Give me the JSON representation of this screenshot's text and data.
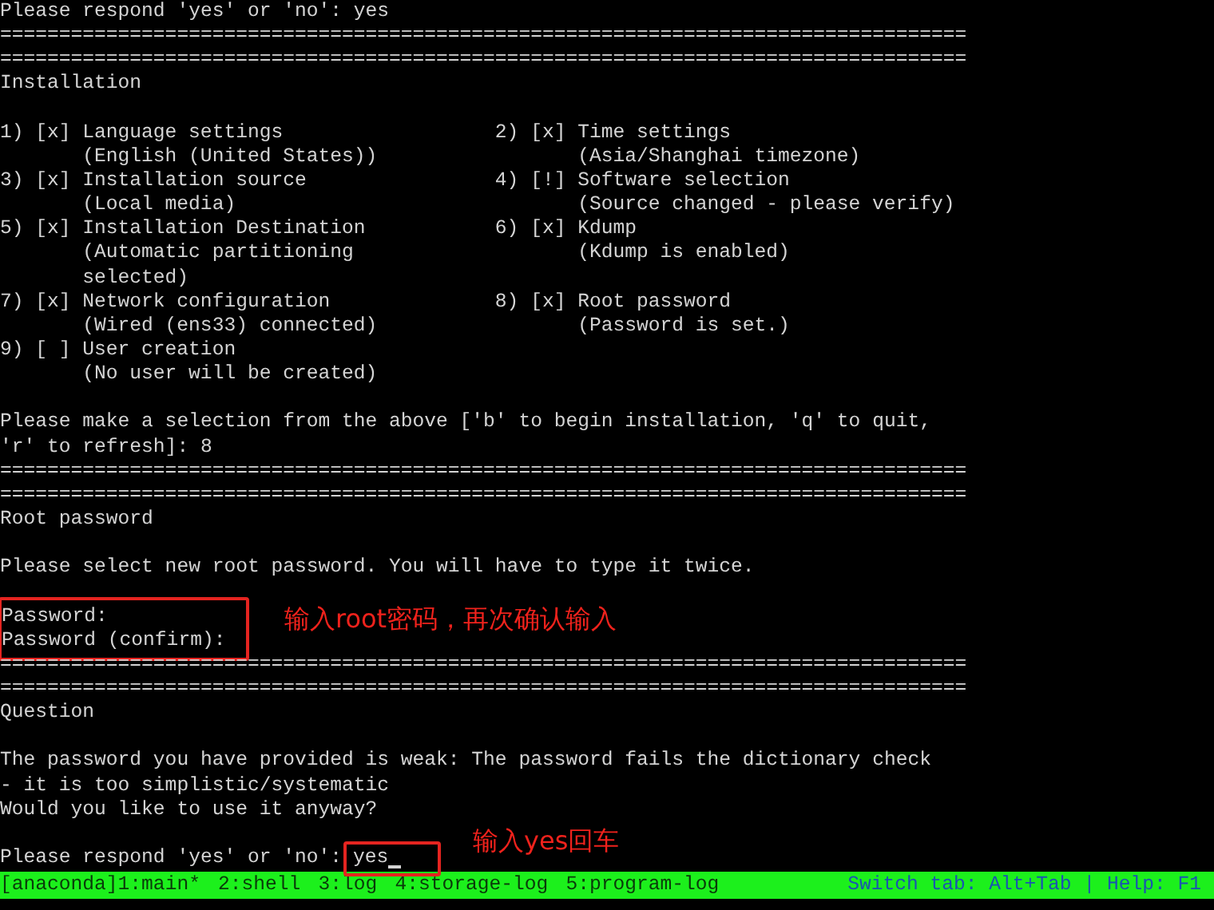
{
  "previous_prompt": "Please respond 'yes' or 'no': yes",
  "installation": {
    "separator": [
      "==================================================================================",
      "=================================================================================="
    ],
    "title": "Installation",
    "items": [
      {
        "number": "1)",
        "status": "[x]",
        "title": "Language settings",
        "details": [
          "(English (United States))"
        ]
      },
      {
        "number": "2)",
        "status": "[x]",
        "title": "Time settings",
        "details": [
          "(Asia/Shanghai timezone)"
        ]
      },
      {
        "number": "3)",
        "status": "[x]",
        "title": "Installation source",
        "details": [
          "(Local media)"
        ]
      },
      {
        "number": "4)",
        "status": "[!]",
        "title": "Software selection",
        "details": [
          "(Source changed - please verify)"
        ]
      },
      {
        "number": "5)",
        "status": "[x]",
        "title": "Installation Destination",
        "details": [
          "(Automatic partitioning",
          "selected)"
        ]
      },
      {
        "number": "6)",
        "status": "[x]",
        "title": "Kdump",
        "details": [
          "(Kdump is enabled)"
        ]
      },
      {
        "number": "7)",
        "status": "[x]",
        "title": "Network configuration",
        "details": [
          "(Wired (ens33) connected)"
        ]
      },
      {
        "number": "8)",
        "status": "[x]",
        "title": "Root password",
        "details": [
          "(Password is set.)"
        ]
      },
      {
        "number": "9)",
        "status": "[ ]",
        "title": "User creation",
        "details": [
          "(No user will be created)"
        ]
      }
    ],
    "prompt": [
      "Please make a selection from the above ['b' to begin installation, 'q' to quit,",
      "'r' to refresh]: 8"
    ]
  },
  "root_password": {
    "separator": [
      "==================================================================================",
      "=================================================================================="
    ],
    "title": "Root password",
    "instruction": "Please select new root password. You will have to type it twice.",
    "fields": [
      "Password:",
      "Password (confirm):"
    ],
    "annotation": "输入root密码，再次确认输入"
  },
  "question": {
    "separator": [
      "==================================================================================",
      "=================================================================================="
    ],
    "title": "Question",
    "message": [
      "The password you have provided is weak: The password fails the dictionary check",
      "- it is too simplistic/systematic",
      "Would you like to use it anyway?"
    ],
    "prompt": "Please respond 'yes' or 'no':",
    "answer": "yes",
    "annotation": "输入yes回车"
  },
  "status_bar": {
    "session": "[anaconda]",
    "tabs": [
      "1:main*",
      "2:shell",
      "3:log",
      "4:storage-log",
      "5:program-log"
    ],
    "help": "Switch tab: Alt+Tab | Help: F1"
  }
}
